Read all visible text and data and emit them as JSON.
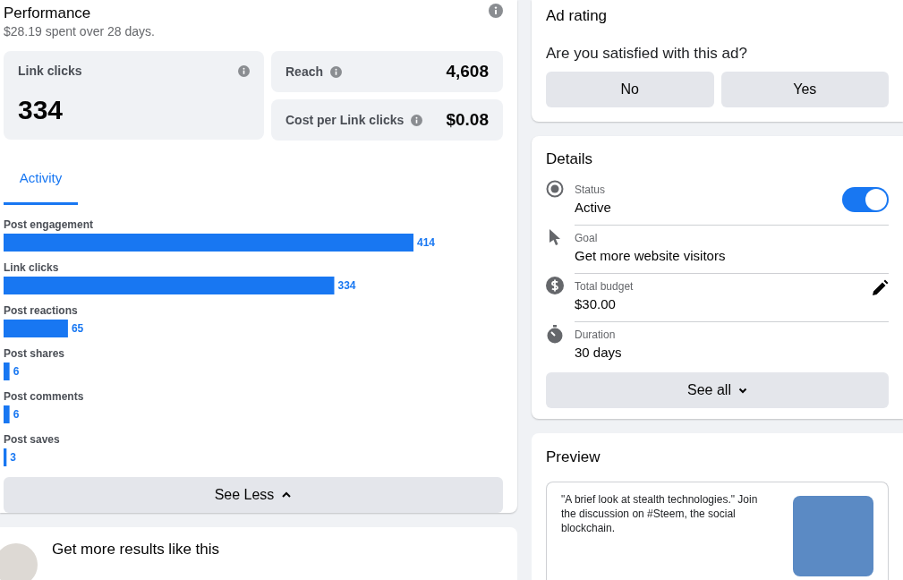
{
  "performance": {
    "title": "Performance",
    "subtitle": "$28.19 spent over 28 days.",
    "main_stat": {
      "label": "Link clicks",
      "value": "334"
    },
    "side_stats": [
      {
        "label": "Reach",
        "value": "4,608"
      },
      {
        "label": "Cost per Link clicks",
        "value": "$0.08"
      }
    ],
    "tabs": [
      {
        "label": "Activity",
        "selected": true
      }
    ],
    "chart_data": {
      "type": "bar",
      "orientation": "horizontal",
      "data_labels": true,
      "categories": [
        "Post engagement",
        "Link clicks",
        "Post reactions",
        "Post shares",
        "Post comments",
        "Post saves"
      ],
      "values": [
        414,
        334,
        65,
        6,
        6,
        3
      ]
    },
    "toggle_button": "See Less"
  },
  "more_results": {
    "title": "Get more results like this"
  },
  "ad_rating": {
    "title": "Ad rating",
    "question": "Are you satisfied with this ad?",
    "buttons": [
      "No",
      "Yes"
    ]
  },
  "details": {
    "title": "Details",
    "items": [
      {
        "kind": "status",
        "label": "Status",
        "value": "Active",
        "on": true
      },
      {
        "kind": "goal",
        "label": "Goal",
        "value": "Get more website visitors"
      },
      {
        "kind": "budget",
        "label": "Total budget",
        "value": "$30.00",
        "editable": true
      },
      {
        "kind": "duration",
        "label": "Duration",
        "value": "30 days"
      }
    ],
    "see_all": "See all"
  },
  "preview": {
    "title": "Preview",
    "text": "\"A brief look at stealth technologies.\" Join the discussion on #Steem, the social blockchain."
  }
}
